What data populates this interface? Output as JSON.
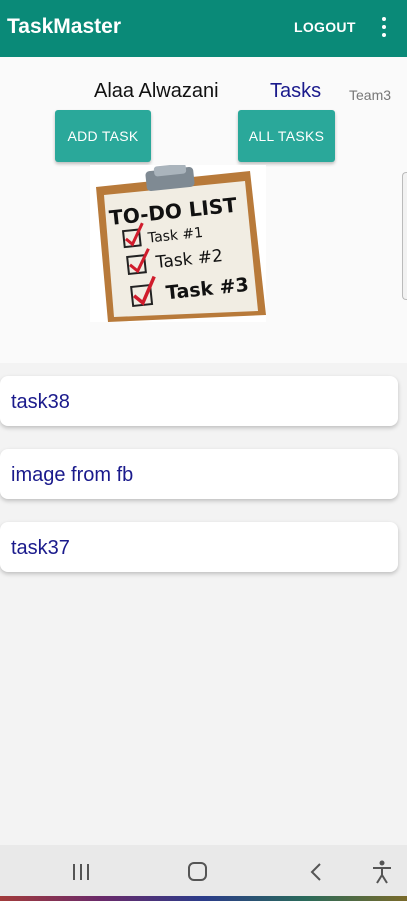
{
  "appbar": {
    "title": "TaskMaster",
    "logout_label": "LOGOUT",
    "menu_icon": "more-vert-icon",
    "color": "#0a8a78"
  },
  "profile": {
    "username": "Alaa Alwazani",
    "tasks_label": "Tasks",
    "team": "Team3"
  },
  "actions": {
    "add_task": "ADD TASK",
    "all_tasks": "ALL TASKS",
    "button_color": "#2aa89a"
  },
  "banner": {
    "heading": "TO-DO LIST",
    "items": [
      "Task #1",
      "Task #2",
      "Task #3"
    ]
  },
  "tasks": [
    {
      "title": "task38"
    },
    {
      "title": "image from fb"
    },
    {
      "title": "task37"
    }
  ],
  "navbar": {
    "icons": [
      "recent-apps-icon",
      "home-icon",
      "back-icon",
      "accessibility-icon"
    ]
  }
}
